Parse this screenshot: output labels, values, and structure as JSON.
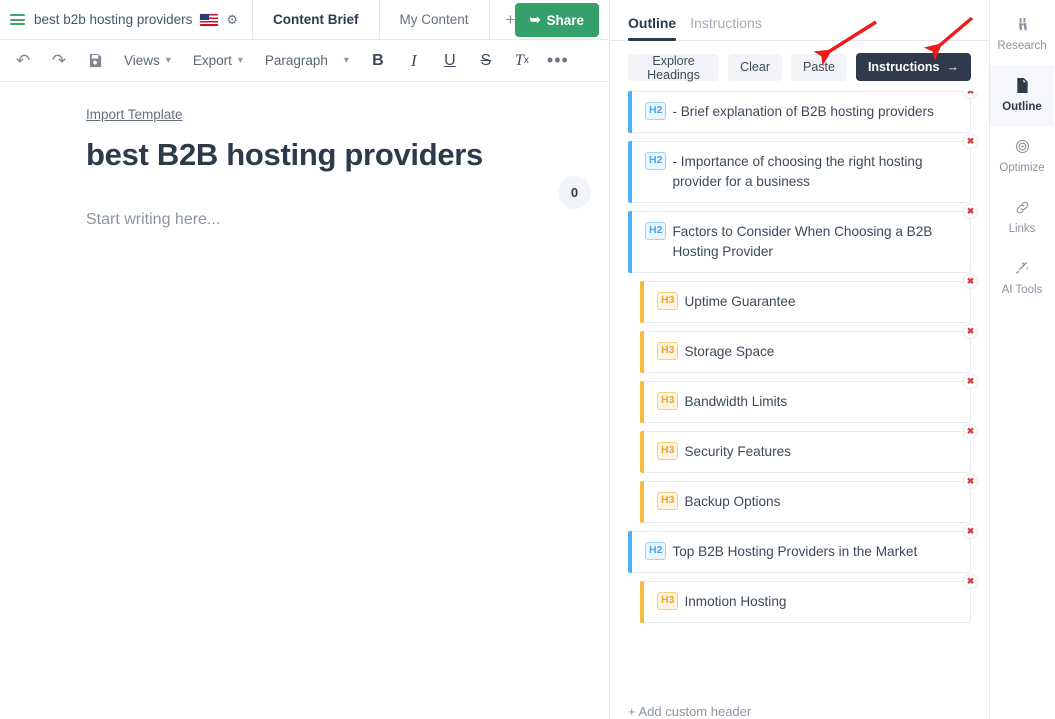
{
  "topbar": {
    "menu_icon": "hamburger-icon",
    "doc_name": "best b2b hosting providers",
    "flag_icon": "us-flag-icon",
    "settings_icon": "gear-icon",
    "tabs": [
      {
        "label": "Content Brief",
        "active": true
      },
      {
        "label": "My Content",
        "active": false
      }
    ],
    "add_tab_label": "+",
    "share_label": "Share",
    "share_icon": "share-arrow-icon",
    "share_color": "#35a06a"
  },
  "toolbar": {
    "undo_icon": "undo-icon",
    "redo_icon": "redo-icon",
    "save_icon": "save-disk-icon",
    "views_label": "Views",
    "export_label": "Export",
    "paragraph_label": "Paragraph",
    "bold_label": "B",
    "italic_label": "I",
    "underline_label": "U",
    "strike_label": "S",
    "clear_format_label": "Tx",
    "more_label": "•••"
  },
  "document": {
    "import_template_label": "Import Template",
    "title": "best B2B hosting providers",
    "placeholder": "Start writing here...",
    "word_count": "0"
  },
  "outline_panel": {
    "tabs": [
      {
        "label": "Outline",
        "active": true
      },
      {
        "label": "Instructions",
        "active": false
      }
    ],
    "actions": {
      "explore_label": "Explore Headings",
      "clear_label": "Clear",
      "paste_label": "Paste",
      "instructions_label": "Instructions",
      "instructions_arrow": "→"
    },
    "items": [
      {
        "level": "H2",
        "text": "- Brief explanation of B2B hosting providers",
        "remove": "✖"
      },
      {
        "level": "H2",
        "text": "- Importance of choosing the right hosting provider for a business",
        "remove": "✖"
      },
      {
        "level": "H2",
        "text": "Factors to Consider When Choosing a B2B Hosting Provider",
        "remove": "✖"
      },
      {
        "level": "H3",
        "text": "Uptime Guarantee",
        "remove": "✖"
      },
      {
        "level": "H3",
        "text": "Storage Space",
        "remove": "✖"
      },
      {
        "level": "H3",
        "text": "Bandwidth Limits",
        "remove": "✖"
      },
      {
        "level": "H3",
        "text": "Security Features",
        "remove": "✖"
      },
      {
        "level": "H3",
        "text": "Backup Options",
        "remove": "✖"
      },
      {
        "level": "H2",
        "text": "Top B2B Hosting Providers in the Market",
        "remove": "✖"
      },
      {
        "level": "H3",
        "text": "Inmotion Hosting",
        "remove": "✖"
      }
    ],
    "add_custom_header_label": "+ Add custom header",
    "h2_accent": "#4db2f0",
    "h3_accent": "#f5bc3e"
  },
  "rail": {
    "items": [
      {
        "label": "Research",
        "icon": "binoculars-icon",
        "active": false
      },
      {
        "label": "Outline",
        "icon": "document-icon",
        "active": true
      },
      {
        "label": "Optimize",
        "icon": "target-icon",
        "active": false
      },
      {
        "label": "Links",
        "icon": "link-icon",
        "active": false
      },
      {
        "label": "AI Tools",
        "icon": "magic-wand-icon",
        "active": false
      }
    ]
  },
  "annotations": {
    "arrow_color": "#ee1c1c",
    "arrow_1_target": "Paste",
    "arrow_2_target": "Instructions"
  }
}
